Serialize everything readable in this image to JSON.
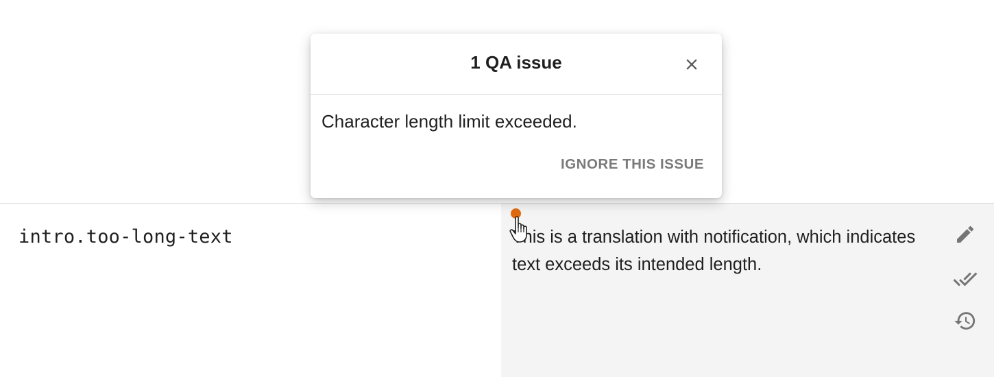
{
  "qa_popup": {
    "title": "1 QA issue",
    "message": "Character length limit exceeded.",
    "ignore_label": "IGNORE THIS ISSUE",
    "close_icon": "close-icon"
  },
  "row": {
    "key": "intro.too-long-text",
    "translation": "This is a translation with notification, which indicates text exceeds its intended length.",
    "notification_color": "#e06a10"
  },
  "actions": {
    "icons": [
      "pencil-icon",
      "double-check-icon",
      "history-icon"
    ]
  },
  "colors": {
    "translation_bg": "#f4f4f4",
    "icon": "#757575",
    "ignore_text": "#7a7a7a"
  }
}
